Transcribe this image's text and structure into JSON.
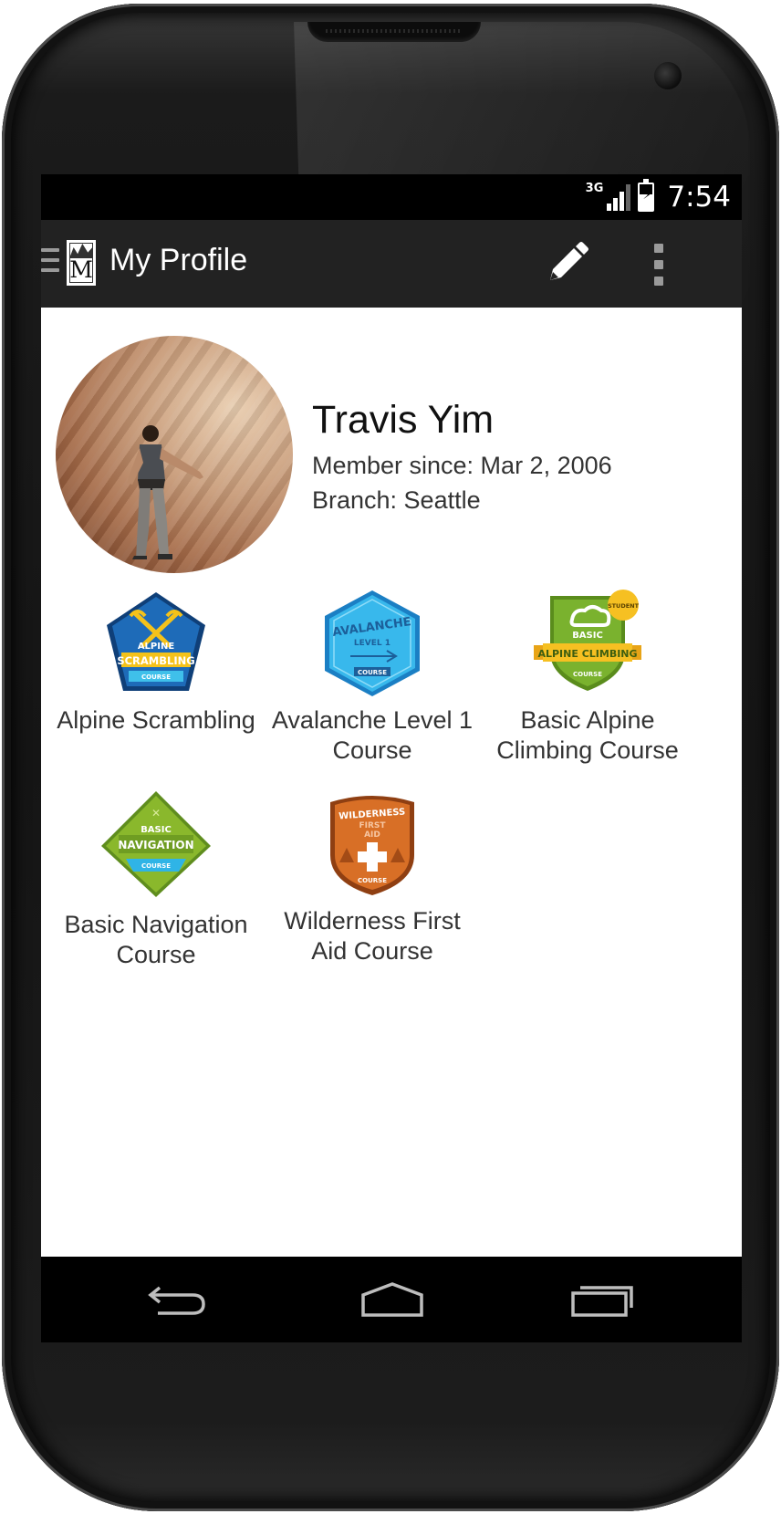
{
  "status_bar": {
    "network": "3G",
    "time": "7:54",
    "signal_icon": "signal-icon",
    "battery_icon": "battery-charging-icon"
  },
  "action_bar": {
    "title": "My Profile",
    "drawer_icon": "drawer-icon",
    "logo_letter": "M",
    "edit_icon": "pencil-icon",
    "overflow_icon": "overflow-menu-icon",
    "background": "#222222"
  },
  "profile": {
    "name": "Travis Yim",
    "member_since": "Member since: Mar 2, 2006",
    "branch": "Branch: Seattle"
  },
  "badges": [
    {
      "label": "Alpine Scrambling",
      "icon": "alpine-scrambling-badge",
      "text": [
        "ALPINE",
        "SCRAMBLING",
        "COURSE"
      ],
      "color": "#1e6bb8"
    },
    {
      "label": "Avalanche Level 1 Course",
      "icon": "avalanche-badge",
      "text": [
        "AVALANCHE",
        "LEVEL 1",
        "COURSE"
      ],
      "color": "#35b6e8"
    },
    {
      "label": "Basic Alpine Climbing Course",
      "icon": "basic-alpine-climbing-badge",
      "text": [
        "BASIC",
        "ALPINE CLIMBING",
        "COURSE",
        "STUDENT"
      ],
      "color": "#7ab22e"
    },
    {
      "label": "Basic Navigation Course",
      "icon": "basic-navigation-badge",
      "text": [
        "BASIC",
        "NAVIGATION",
        "COURSE"
      ],
      "color": "#8ab82c"
    },
    {
      "label": "Wilderness First Aid Course",
      "icon": "wilderness-first-aid-badge",
      "text": [
        "WILDERNESS",
        "FIRST",
        "AID",
        "COURSE"
      ],
      "color": "#d86f26"
    }
  ],
  "nav_bar": {
    "back_icon": "back-icon",
    "home_icon": "home-icon",
    "recents_icon": "recent-apps-icon"
  }
}
